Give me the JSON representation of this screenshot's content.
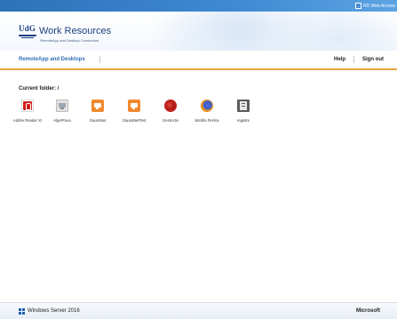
{
  "topbar": {
    "rd_link": "RD Web Access"
  },
  "header": {
    "logo_text": "UdG",
    "title": "Work Resources",
    "subtitle": "RemoteApp and Desktop Connection"
  },
  "nav": {
    "title": "RemoteApp and Desktops",
    "help": "Help",
    "sign_out": "Sign out"
  },
  "content": {
    "current_folder": "Current folder: /",
    "apps": [
      {
        "label": "Adobe Reader XI",
        "icon": "adobe-reader-icon"
      },
      {
        "label": "AlgeProva",
        "icon": "alga-icon"
      },
      {
        "label": "GaussNet",
        "icon": "gauss-icon"
      },
      {
        "label": "GaussNetTest",
        "icon": "gauss-test-icon"
      },
      {
        "label": "GestActiv",
        "icon": "gestactiv-icon"
      },
      {
        "label": "Mozilla Firefox",
        "icon": "firefox-icon"
      },
      {
        "label": "registre",
        "icon": "registre-icon"
      }
    ]
  },
  "footer": {
    "os": "Windows Server 2016",
    "vendor": "Microsoft"
  },
  "colors": {
    "accent_blue": "#2c72b8",
    "accent_orange": "#e8a33a",
    "nav_blue": "#2f6fb5"
  }
}
